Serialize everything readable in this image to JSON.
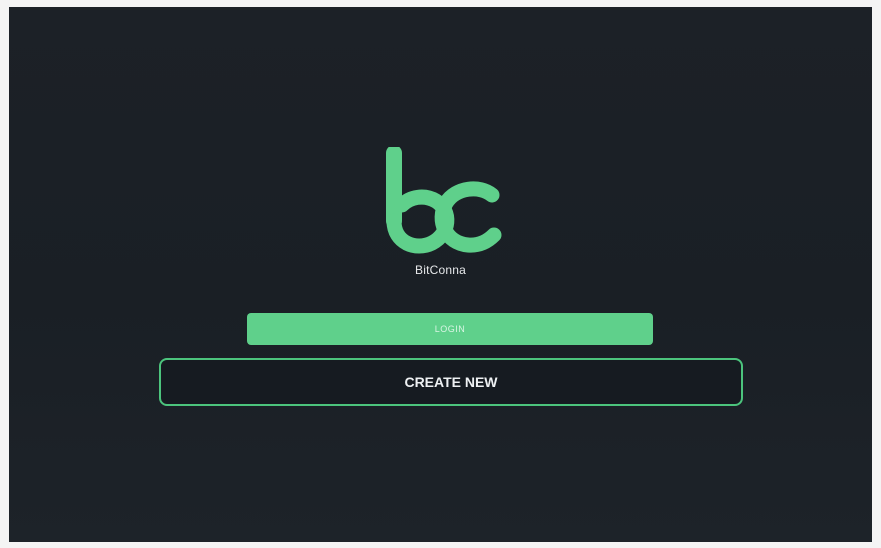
{
  "app": {
    "brand_name": "BitConna",
    "logo_icon": "bitconna-bc-logo",
    "accent_color": "#5fd08b",
    "background_color": "#1c2127"
  },
  "actions": {
    "login_label": "LOGIN",
    "create_new_label": "CREATE NEW"
  }
}
